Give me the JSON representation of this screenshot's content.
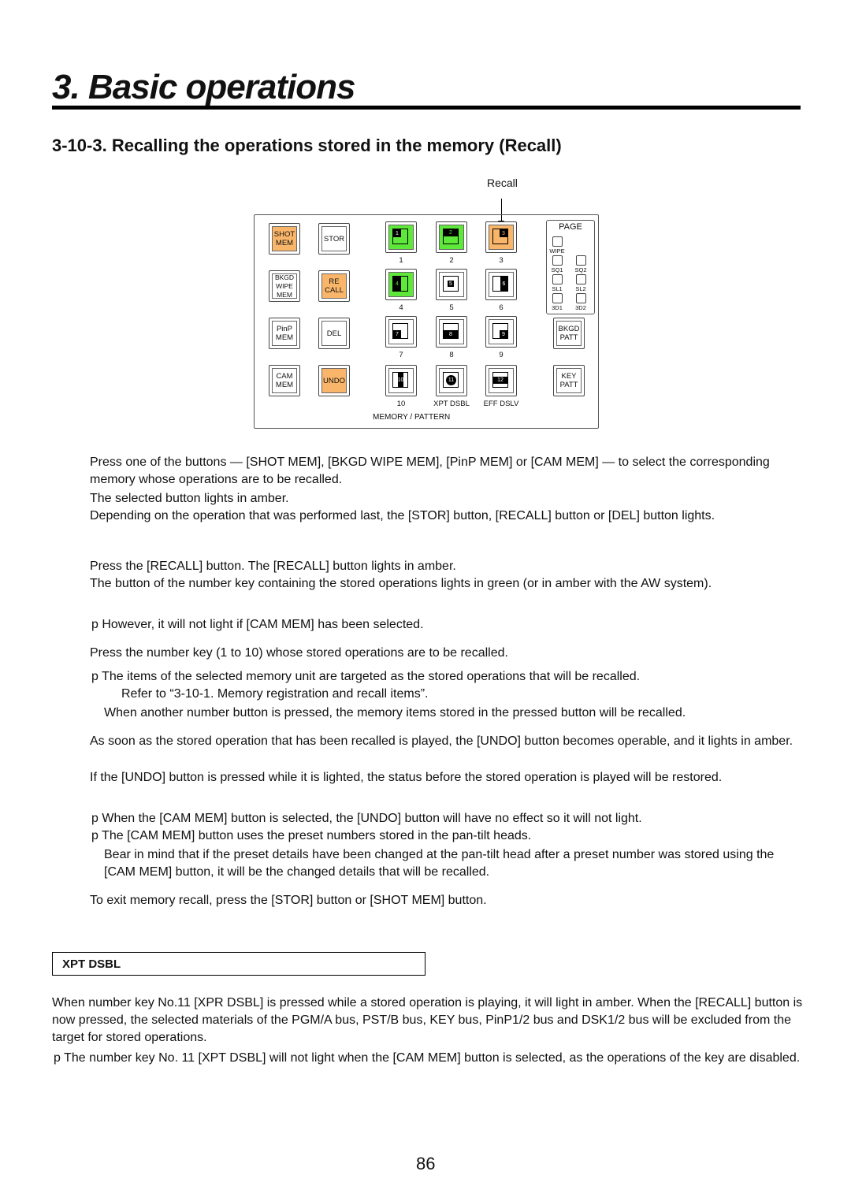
{
  "header": {
    "title": "3. Basic operations",
    "subtitle": "3-10-3. Recalling the operations stored in the memory (Recall)"
  },
  "diagram": {
    "callout": "Recall",
    "mem_buttons": [
      {
        "label": "SHOT MEM",
        "state": "amber"
      },
      {
        "label": "STOR",
        "state": "off"
      },
      {
        "label": "BKGD WIPE MEM",
        "state": "off"
      },
      {
        "label": "RE CALL",
        "state": "amber"
      },
      {
        "label": "PinP MEM",
        "state": "off"
      },
      {
        "label": "DEL",
        "state": "off"
      },
      {
        "label": "CAM MEM",
        "state": "off"
      },
      {
        "label": "UNDO",
        "state": "amber"
      }
    ],
    "number_keys": [
      {
        "num": "1",
        "caption": "1",
        "state": "green"
      },
      {
        "num": "2",
        "caption": "2",
        "state": "green"
      },
      {
        "num": "3",
        "caption": "3",
        "state": "amber"
      },
      {
        "num": "4",
        "caption": "4",
        "state": "green"
      },
      {
        "num": "5",
        "caption": "5",
        "state": "off"
      },
      {
        "num": "6",
        "caption": "6",
        "state": "off"
      },
      {
        "num": "7",
        "caption": "7",
        "state": "off"
      },
      {
        "num": "8",
        "caption": "8",
        "state": "off"
      },
      {
        "num": "9",
        "caption": "9",
        "state": "off"
      },
      {
        "num": "10",
        "caption": "10",
        "state": "off"
      },
      {
        "num": "11",
        "caption": "XPT DSBL",
        "state": "off"
      },
      {
        "num": "12",
        "caption": "EFF DSLV",
        "state": "off"
      }
    ],
    "page": {
      "title": "PAGE",
      "items": [
        "WIPE",
        "SQ1",
        "SQ2",
        "SL1",
        "SL2",
        "3D1",
        "3D2"
      ]
    },
    "patt_buttons": [
      "BKGD PATT",
      "KEY PATT"
    ],
    "section_label": "MEMORY / PATTERN"
  },
  "body": {
    "p1": "Press one of the buttons — [SHOT MEM], [BKGD WIPE MEM], [PinP MEM] or [CAM MEM] — to select the corresponding memory whose operations are to be recalled.",
    "p2": "The selected button lights in amber.",
    "p3": "Depending on the operation that was performed last, the [STOR] button, [RECALL] button or [DEL] button lights.",
    "p4": "Press the [RECALL] button. The [RECALL] button lights in amber.",
    "p5": "The button of the number key containing the stored operations lights in green (or in amber with the AW system).",
    "p6": "p However, it will not light if [CAM MEM] has been selected.",
    "p7": "Press the number key (1 to 10) whose stored operations are to be recalled.",
    "p8": "p The items of the selected memory unit are targeted as the stored operations that will be recalled.",
    "p9": "Refer to “3-10-1. Memory registration and recall items”.",
    "p10": "When another number button is pressed, the memory items stored in the pressed button will be recalled.",
    "p11": "As soon as the stored operation that has been recalled is played, the [UNDO] button becomes operable, and it lights in amber.",
    "p12": "If the [UNDO] button is pressed while it is lighted, the status before the stored operation is played will be restored.",
    "p13": "p When the [CAM MEM] button is selected, the [UNDO] button will have no effect so it will not light.",
    "p14": "p The [CAM MEM] button uses the preset numbers stored in the pan-tilt heads.",
    "p15": "Bear in mind that if the preset details have been changed at the pan-tilt head after a preset number was stored using the [CAM MEM] button, it will be the changed details that will be recalled.",
    "p16": "To exit memory recall, press the [STOR] button or [SHOT MEM] button."
  },
  "note": {
    "title": "XPT DSBL",
    "p1": "When number key No.11 [XPR DSBL] is pressed while a stored operation is playing, it will light in amber. When the [RECALL] button is now pressed, the selected materials of the PGM/A bus, PST/B bus, KEY bus, PinP1/2 bus and DSK1/2 bus will be excluded from the target for stored operations.",
    "p2": "p The number key No. 11 [XPT DSBL] will not light when the [CAM MEM] button is selected, as the operations of the key are disabled."
  },
  "footer": {
    "page_number": "86"
  }
}
